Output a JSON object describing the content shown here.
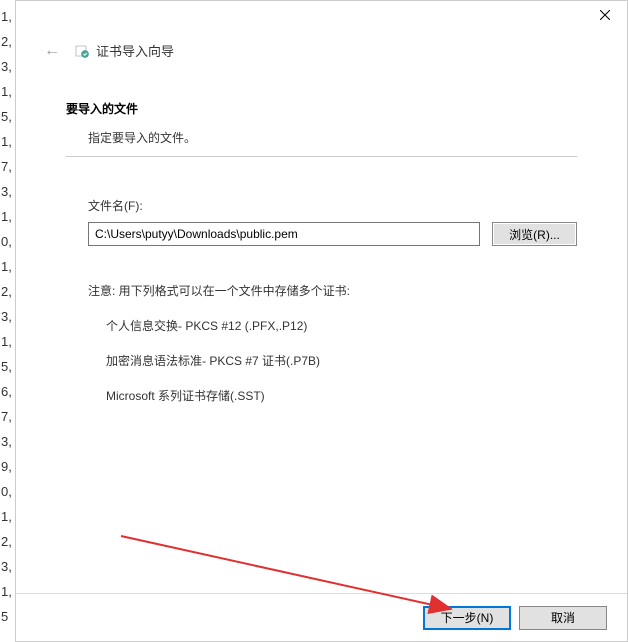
{
  "left_strip": [
    "1,",
    "2,",
    "3,",
    "1,",
    "5,",
    "1,",
    "7,",
    "3,",
    "1,",
    "0,",
    "1,",
    "2,",
    "3,",
    "1,",
    "5,",
    "6,",
    "7,",
    "3,",
    "9,",
    "0,",
    "1,",
    "2,",
    "3,",
    "1,",
    "5"
  ],
  "header": {
    "wizard_title": "证书导入向导"
  },
  "content": {
    "section_title": "要导入的文件",
    "section_desc": "指定要导入的文件。",
    "file_label": "文件名(F):",
    "file_value": "C:\\Users\\putyy\\Downloads\\public.pem",
    "browse_label": "浏览(R)...",
    "note": "注意: 用下列格式可以在一个文件中存储多个证书:",
    "formats": [
      "个人信息交换- PKCS #12 (.PFX,.P12)",
      "加密消息语法标准- PKCS #7 证书(.P7B)",
      "Microsoft 系列证书存储(.SST)"
    ]
  },
  "footer": {
    "next_label": "下一步(N)",
    "cancel_label": "取消"
  }
}
